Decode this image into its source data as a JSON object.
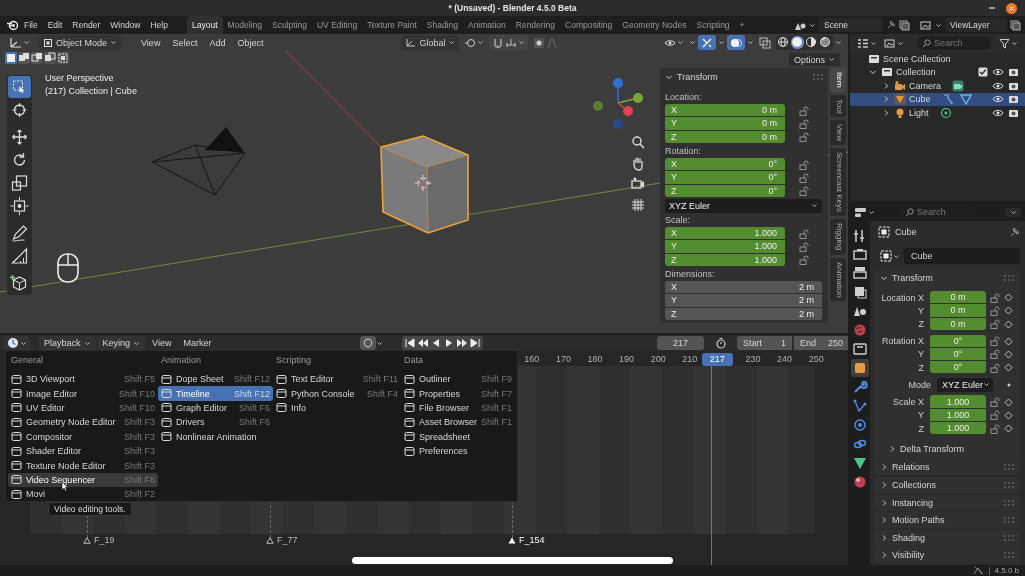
{
  "window": {
    "title": "* (Unsaved) - Blender 4.5.0 Beta"
  },
  "menu_bar": [
    "File",
    "Edit",
    "Render",
    "Window",
    "Help"
  ],
  "workspaces": [
    {
      "label": "Layout",
      "selected": true
    },
    {
      "label": "Modeling",
      "selected": false
    },
    {
      "label": "Sculpting",
      "selected": false
    },
    {
      "label": "UV Editing",
      "selected": false
    },
    {
      "label": "Texture Paint",
      "selected": false
    },
    {
      "label": "Shading",
      "selected": false
    },
    {
      "label": "Animation",
      "selected": false
    },
    {
      "label": "Rendering",
      "selected": false
    },
    {
      "label": "Compositing",
      "selected": false
    },
    {
      "label": "Geometry Nodes",
      "selected": false
    },
    {
      "label": "Scripting",
      "selected": false
    }
  ],
  "add_workspace": "+",
  "scene": "Scene",
  "view_layer": "ViewLayer",
  "viewport": {
    "mode": "Object Mode",
    "menus": [
      "View",
      "Select",
      "Add",
      "Object"
    ],
    "orientation": "Global",
    "select_modes": [
      {
        "kind": "set",
        "selected": true
      },
      {
        "kind": "extend",
        "selected": false
      },
      {
        "kind": "subtract",
        "selected": false
      },
      {
        "kind": "invert",
        "selected": false
      },
      {
        "kind": "intersect",
        "selected": false
      }
    ],
    "shading_modes": [
      {
        "kind": "wireframe",
        "selected": false
      },
      {
        "kind": "solid",
        "selected": true
      },
      {
        "kind": "material",
        "selected": false
      },
      {
        "kind": "rendered",
        "selected": false
      }
    ],
    "tools": [
      {
        "kind": "select_box",
        "selected": true
      },
      {
        "kind": "cursor",
        "selected": false
      },
      {
        "kind": "move",
        "selected": false
      },
      {
        "kind": "rotate",
        "selected": false
      },
      {
        "kind": "scale",
        "selected": false
      },
      {
        "kind": "transform",
        "selected": false
      },
      {
        "kind": "annotate",
        "selected": false
      },
      {
        "kind": "measure",
        "selected": false
      },
      {
        "kind": "add_cube",
        "selected": false
      }
    ],
    "view_name": "User Perspective",
    "context": "(217) Collection | Cube",
    "options": "Options",
    "sidebar_tabs": [
      {
        "label": "Item",
        "selected": true
      },
      {
        "label": "Tool",
        "selected": false
      },
      {
        "label": "View",
        "selected": false
      },
      {
        "label": "Screencast Keys",
        "selected": false
      },
      {
        "label": "Rigging",
        "selected": false
      },
      {
        "label": "Animation",
        "selected": false
      }
    ],
    "transform": {
      "title": "Transform",
      "expanded": true,
      "groups": [
        {
          "label": "Location:",
          "animated": true,
          "fields": [
            {
              "axis": "X",
              "value": "0 m"
            },
            {
              "axis": "Y",
              "value": "0 m"
            },
            {
              "axis": "Z",
              "value": "0 m"
            }
          ]
        },
        {
          "label": "Rotation:",
          "animated": true,
          "fields": [
            {
              "axis": "X",
              "value": "0°"
            },
            {
              "axis": "Y",
              "value": "0°"
            },
            {
              "axis": "Z",
              "value": "0°"
            }
          ],
          "mode": "XYZ Euler"
        },
        {
          "label": "Scale:",
          "animated": true,
          "fields": [
            {
              "axis": "X",
              "value": "1.000"
            },
            {
              "axis": "Y",
              "value": "1.000"
            },
            {
              "axis": "Z",
              "value": "1.000"
            }
          ]
        },
        {
          "label": "Dimensions:",
          "animated": false,
          "fields": [
            {
              "axis": "X",
              "value": "2 m"
            },
            {
              "axis": "Y",
              "value": "2 m"
            },
            {
              "axis": "Z",
              "value": "2 m"
            }
          ]
        }
      ]
    }
  },
  "timeline": {
    "menus": [
      {
        "label": "Playback",
        "dropdown": true
      },
      {
        "label": "Keying",
        "dropdown": true
      },
      {
        "label": "View",
        "dropdown": false
      },
      {
        "label": "Marker",
        "dropdown": false
      }
    ],
    "current_frame": "217",
    "start_label": "Start",
    "start": "1",
    "end_label": "End",
    "end": "250",
    "ruler_before": [
      "160",
      "170",
      "180",
      "190",
      "200",
      "210"
    ],
    "playhead": "217",
    "ruler_after": [
      "230",
      "240",
      "250"
    ],
    "markers": [
      {
        "label": "F_19",
        "selected": false
      },
      {
        "label": "F_77",
        "selected": false
      },
      {
        "label": "F_154",
        "selected": true
      }
    ]
  },
  "editor_menu": {
    "columns": [
      {
        "title": "General",
        "items": [
          {
            "label": "3D Viewport",
            "shortcut": "Shift F5",
            "selected": false,
            "hovered": false
          },
          {
            "label": "Image Editor",
            "shortcut": "Shift F10",
            "selected": false,
            "hovered": false
          },
          {
            "label": "UV Editor",
            "shortcut": "Shift F10",
            "selected": false,
            "hovered": false
          },
          {
            "label": "Geometry Node Editor",
            "shortcut": "Shift F3",
            "selected": false,
            "hovered": false
          },
          {
            "label": "Compositor",
            "shortcut": "Shift F3",
            "selected": false,
            "hovered": false
          },
          {
            "label": "Shader Editor",
            "shortcut": "Shift F3",
            "selected": false,
            "hovered": false
          },
          {
            "label": "Texture Node Editor",
            "shortcut": "Shift F3",
            "selected": false,
            "hovered": false
          },
          {
            "label": "Video Sequencer",
            "shortcut": "Shift F8",
            "selected": false,
            "hovered": true
          },
          {
            "label": "Movi",
            "shortcut": "Shift F2",
            "selected": false,
            "hovered": false
          }
        ]
      },
      {
        "title": "Animation",
        "items": [
          {
            "label": "Dope Sheet",
            "shortcut": "Shift F12",
            "selected": false,
            "hovered": false
          },
          {
            "label": "Timeline",
            "shortcut": "Shift F12",
            "selected": true,
            "hovered": false
          },
          {
            "label": "Graph Editor",
            "shortcut": "Shift F6",
            "selected": false,
            "hovered": false
          },
          {
            "label": "Drivers",
            "shortcut": "Shift F6",
            "selected": false,
            "hovered": false
          },
          {
            "label": "Nonlinear Animation",
            "selected": false,
            "hovered": false
          }
        ]
      },
      {
        "title": "Scripting",
        "items": [
          {
            "label": "Text Editor",
            "shortcut": "Shift F11",
            "selected": false,
            "hovered": false
          },
          {
            "label": "Python Console",
            "shortcut": "Shift F4",
            "selected": false,
            "hovered": false
          },
          {
            "label": "Info",
            "selected": false,
            "hovered": false
          }
        ]
      },
      {
        "title": "Data",
        "items": [
          {
            "label": "Outliner",
            "shortcut": "Shift F9",
            "selected": false,
            "hovered": false
          },
          {
            "label": "Properties",
            "shortcut": "Shift F7",
            "selected": false,
            "hovered": false
          },
          {
            "label": "File Browser",
            "shortcut": "Shift F1",
            "selected": false,
            "hovered": false
          },
          {
            "label": "Asset Browser",
            "shortcut": "Shift F1",
            "selected": false,
            "hovered": false
          },
          {
            "label": "Spreadsheet",
            "selected": false,
            "hovered": false
          },
          {
            "label": "Preferences",
            "selected": false,
            "hovered": false
          }
        ]
      }
    ],
    "tooltip": "Video editing tools."
  },
  "outliner": {
    "search_placeholder": "Search",
    "tree": [
      {
        "label": "Scene Collection",
        "kind": "scene_collection",
        "selected": false,
        "children": [
          {
            "label": "Collection",
            "kind": "collection",
            "selected": false,
            "expanded": true,
            "checked": true,
            "children": [
              {
                "label": "Camera",
                "kind": "camera",
                "selected": false,
                "expanded": false
              },
              {
                "label": "Cube",
                "kind": "mesh",
                "selected": true,
                "expanded": false
              },
              {
                "label": "Light",
                "kind": "light",
                "selected": false,
                "expanded": false
              }
            ]
          }
        ]
      }
    ]
  },
  "properties": {
    "search_placeholder": "Search",
    "tabs": [
      {
        "kind": "tool",
        "selected": false
      },
      {
        "kind": "render",
        "selected": false
      },
      {
        "kind": "output",
        "selected": false
      },
      {
        "kind": "view_layer",
        "selected": false
      },
      {
        "kind": "scene",
        "selected": false
      },
      {
        "kind": "world",
        "selected": false
      },
      {
        "kind": "collection",
        "selected": false
      },
      {
        "kind": "object",
        "selected": true
      },
      {
        "kind": "modifiers",
        "selected": false
      },
      {
        "kind": "particles",
        "selected": false
      },
      {
        "kind": "physics",
        "selected": false
      },
      {
        "kind": "constraints",
        "selected": false
      },
      {
        "kind": "data",
        "selected": false
      },
      {
        "kind": "material",
        "selected": false
      }
    ],
    "object_name": "Cube",
    "data_name": "Cube",
    "transform": {
      "title": "Transform",
      "expanded": true,
      "groups": [
        {
          "kind": "fields",
          "rows": [
            {
              "label": "Location X",
              "value": "0 m"
            },
            {
              "label": "Y",
              "value": "0 m"
            },
            {
              "label": "Z",
              "value": "0 m"
            }
          ]
        },
        {
          "kind": "fields",
          "rows": [
            {
              "label": "Rotation X",
              "value": "0°"
            },
            {
              "label": "Y",
              "value": "0°"
            },
            {
              "label": "Z",
              "value": "0°"
            }
          ]
        },
        {
          "kind": "dropdown",
          "label": "Mode",
          "value": "XYZ Euler"
        },
        {
          "kind": "fields",
          "rows": [
            {
              "label": "Scale X",
              "value": "1.000"
            },
            {
              "label": "Y",
              "value": "1.000"
            },
            {
              "label": "Z",
              "value": "1.000"
            }
          ]
        }
      ],
      "subpanels": [
        {
          "title": "Delta Transform",
          "expanded": false
        }
      ]
    },
    "panels": [
      {
        "title": "Relations",
        "expanded": false
      },
      {
        "title": "Collections",
        "expanded": false
      },
      {
        "title": "Instancing",
        "expanded": false
      },
      {
        "title": "Motion Paths",
        "expanded": false
      },
      {
        "title": "Shading",
        "expanded": false
      },
      {
        "title": "Visibility",
        "expanded": false
      }
    ]
  },
  "status_bar": {
    "version": "4.5.0 b"
  }
}
